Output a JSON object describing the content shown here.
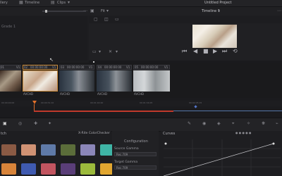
{
  "topbar": {
    "gallery_label": "llery",
    "timeline_label": "Timeline",
    "clips_label": "Clips",
    "project_title": "Untitled Project"
  },
  "bar2": {
    "fit_label": "Fit",
    "timeline_select": "Timeline 1"
  },
  "media": {
    "grade_label": "Grade 1"
  },
  "clips": [
    {
      "num": "01",
      "tc": "00:00:00:00",
      "track": "V1",
      "codec": "AVCHD"
    },
    {
      "num": "02",
      "tc": "00:00:00:00",
      "track": "V1",
      "codec": "AVCHD"
    },
    {
      "num": "03",
      "tc": "00:00:00:00",
      "track": "V1",
      "codec": "AVCHD"
    },
    {
      "num": "04",
      "tc": "00:00:00:00",
      "track": "V1",
      "codec": "AVCHD"
    },
    {
      "num": "05",
      "tc": "00:00:00:00",
      "track": "V1",
      "codec": "AVCHD"
    }
  ],
  "ruler_ticks": [
    "00:00:00:00",
    "00:00:31:10",
    "00:01:02:20",
    "00:01:34:05",
    "00:02:05:15"
  ],
  "swatch_panel": {
    "title": "tch",
    "checker": "X-Rite ColorChecker",
    "swatches": [
      "#8a5a44",
      "#d09274",
      "#5f7aa8",
      "#5b6d3a",
      "#8b86b8",
      "#3fb5a6",
      "#d8843a",
      "#3f5ab0",
      "#c25560",
      "#5a3e78",
      "#9cba3c",
      "#e1a630"
    ]
  },
  "config": {
    "title": "Configuration",
    "source_label": "Source Gamma",
    "source_value": "Rec.709",
    "target_label": "Target Gamma",
    "target_value": "Rec.709"
  },
  "curves": {
    "title": "Curves"
  }
}
